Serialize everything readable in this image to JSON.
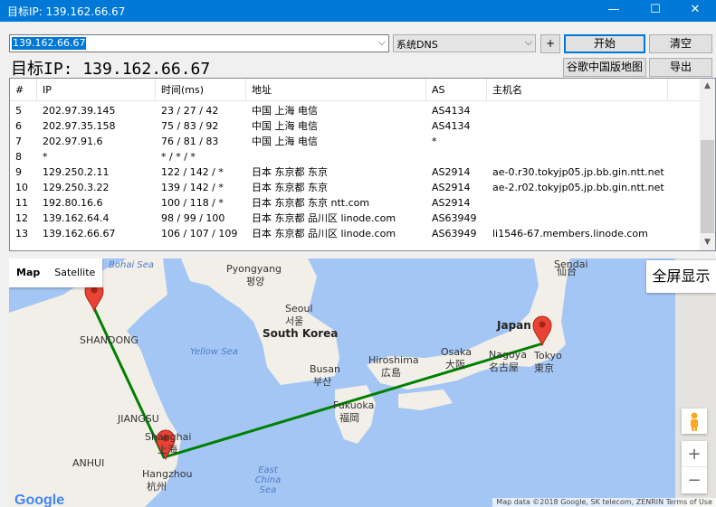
{
  "window": {
    "title": "目标IP: 139.162.66.67",
    "minimize": "—",
    "maximize": "☐",
    "close": "✕"
  },
  "toolbar": {
    "ip_value": "139.162.66.67",
    "dns_value": "系统DNS",
    "plus_label": "+",
    "start_label": "开始",
    "clear_label": "清空",
    "map_china_label": "谷歌中国版地图",
    "export_label": "导出"
  },
  "target_label": "目标IP: 139.162.66.67",
  "table": {
    "headers": [
      "#",
      "IP",
      "时间(ms)",
      "地址",
      "AS",
      "主机名"
    ],
    "rows": [
      [
        "5",
        "202.97.39.145",
        "23 / 27 / 42",
        "中国 上海 电信",
        "AS4134",
        ""
      ],
      [
        "6",
        "202.97.35.158",
        "75 / 83 / 92",
        "中国 上海 电信",
        "AS4134",
        ""
      ],
      [
        "7",
        "202.97.91.6",
        "76 / 81 / 83",
        "中国 上海 电信",
        "*",
        ""
      ],
      [
        "8",
        "*",
        "* / * / *",
        "",
        "",
        ""
      ],
      [
        "9",
        "129.250.2.11",
        "122 / 142 / *",
        "日本 东京都 东京",
        "AS2914",
        "ae-0.r30.tokyjp05.jp.bb.gin.ntt.net"
      ],
      [
        "10",
        "129.250.3.22",
        "139 / 142 / *",
        "日本 东京都 东京",
        "AS2914",
        "ae-2.r02.tokyjp05.jp.bb.gin.ntt.net"
      ],
      [
        "11",
        "192.80.16.6",
        "100 / 118 / *",
        "日本 东京都 东京 ntt.com",
        "AS2914",
        ""
      ],
      [
        "12",
        "139.162.64.4",
        "98 / 99 / 100",
        "日本 东京都 品川区 linode.com",
        "AS63949",
        ""
      ],
      [
        "13",
        "139.162.66.67",
        "106 / 107 / 109",
        "日本 东京都 品川区 linode.com",
        "AS63949",
        "li1546-67.members.linode.com"
      ]
    ]
  },
  "map": {
    "type_map": "Map",
    "type_satellite": "Satellite",
    "fullscreen": "全屏显示",
    "zoom_in": "+",
    "zoom_out": "−",
    "logo": "Google",
    "attribution": "Map data ©2018 Google, SK telecom, ZENRIN   Terms of Use",
    "labels": {
      "bohai": "Bohai Sea",
      "pyongyang": "Pyongyang",
      "pyongyang_kr": "평양",
      "seoul": "Seoul",
      "seoul_kr": "서울",
      "south_korea": "South Korea",
      "shandong": "SHANDONG",
      "yellow_sea": "Yellow Sea",
      "busan": "Busan",
      "busan_kr": "부산",
      "hiroshima": "Hiroshima",
      "hiroshima_jp": "広島",
      "osaka": "Osaka",
      "osaka_jp": "大阪",
      "nagoya": "Nagoya",
      "nagoya_jp": "名古屋",
      "japan": "Japan",
      "tokyo": "Tokyo",
      "tokyo_jp": "東京",
      "sendai": "Sendai",
      "sendai_jp": "仙台",
      "fukuoka": "Fukuoka",
      "fukuoka_jp": "福岡",
      "jiangsu": "JIANGSU",
      "shanghai": "Shanghai",
      "shanghai_cn": "上海",
      "anhui": "ANHUI",
      "hangzhou": "Hangzhou",
      "hangzhou_cn": "杭州",
      "east_china_sea": "East China Sea"
    },
    "colors": {
      "water": "#a4c6f4",
      "land": "#f2efe9",
      "route": "#008000",
      "marker": "#ea4335"
    }
  }
}
